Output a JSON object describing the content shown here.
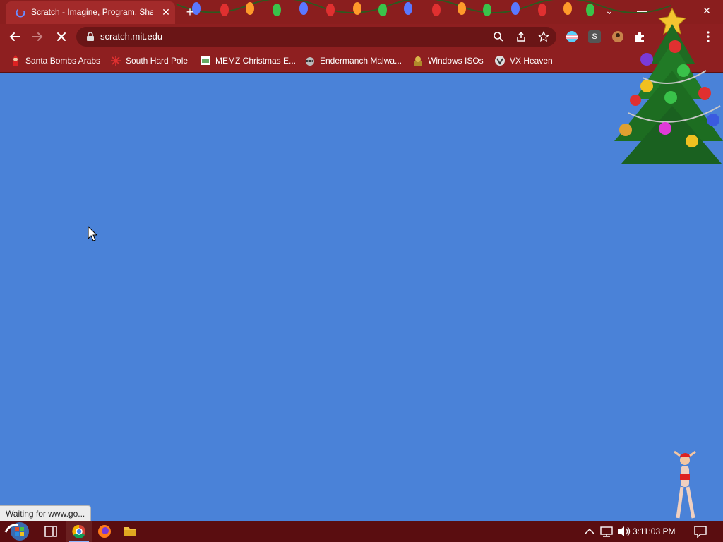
{
  "window": {
    "tab_title": "Scratch - Imagine, Program, Share",
    "tab_close": "✕",
    "new_tab": "+",
    "controls": [
      "⌄",
      "—",
      "",
      "✕"
    ]
  },
  "toolbar": {
    "url": "scratch.mit.edu",
    "profile_letter": "S"
  },
  "bookmarks": [
    {
      "label": "Santa Bombs Arabs",
      "icon": "santa-icon"
    },
    {
      "label": "South Hard Pole",
      "icon": "snowflake-icon"
    },
    {
      "label": "MEMZ Christmas E...",
      "icon": "memz-icon"
    },
    {
      "label": "Endermanch Malwa...",
      "icon": "raccoon-icon"
    },
    {
      "label": "Windows ISOs",
      "icon": "cd-icon"
    },
    {
      "label": "VX Heaven",
      "icon": "vx-icon"
    }
  ],
  "status_bar": "Waiting for www.go...",
  "taskbar": {
    "clock": "3:11:03 PM"
  },
  "colors": {
    "page_background": "#4a82d8",
    "chrome_red": "#8e1f20",
    "taskbar": "#5a0d10"
  }
}
